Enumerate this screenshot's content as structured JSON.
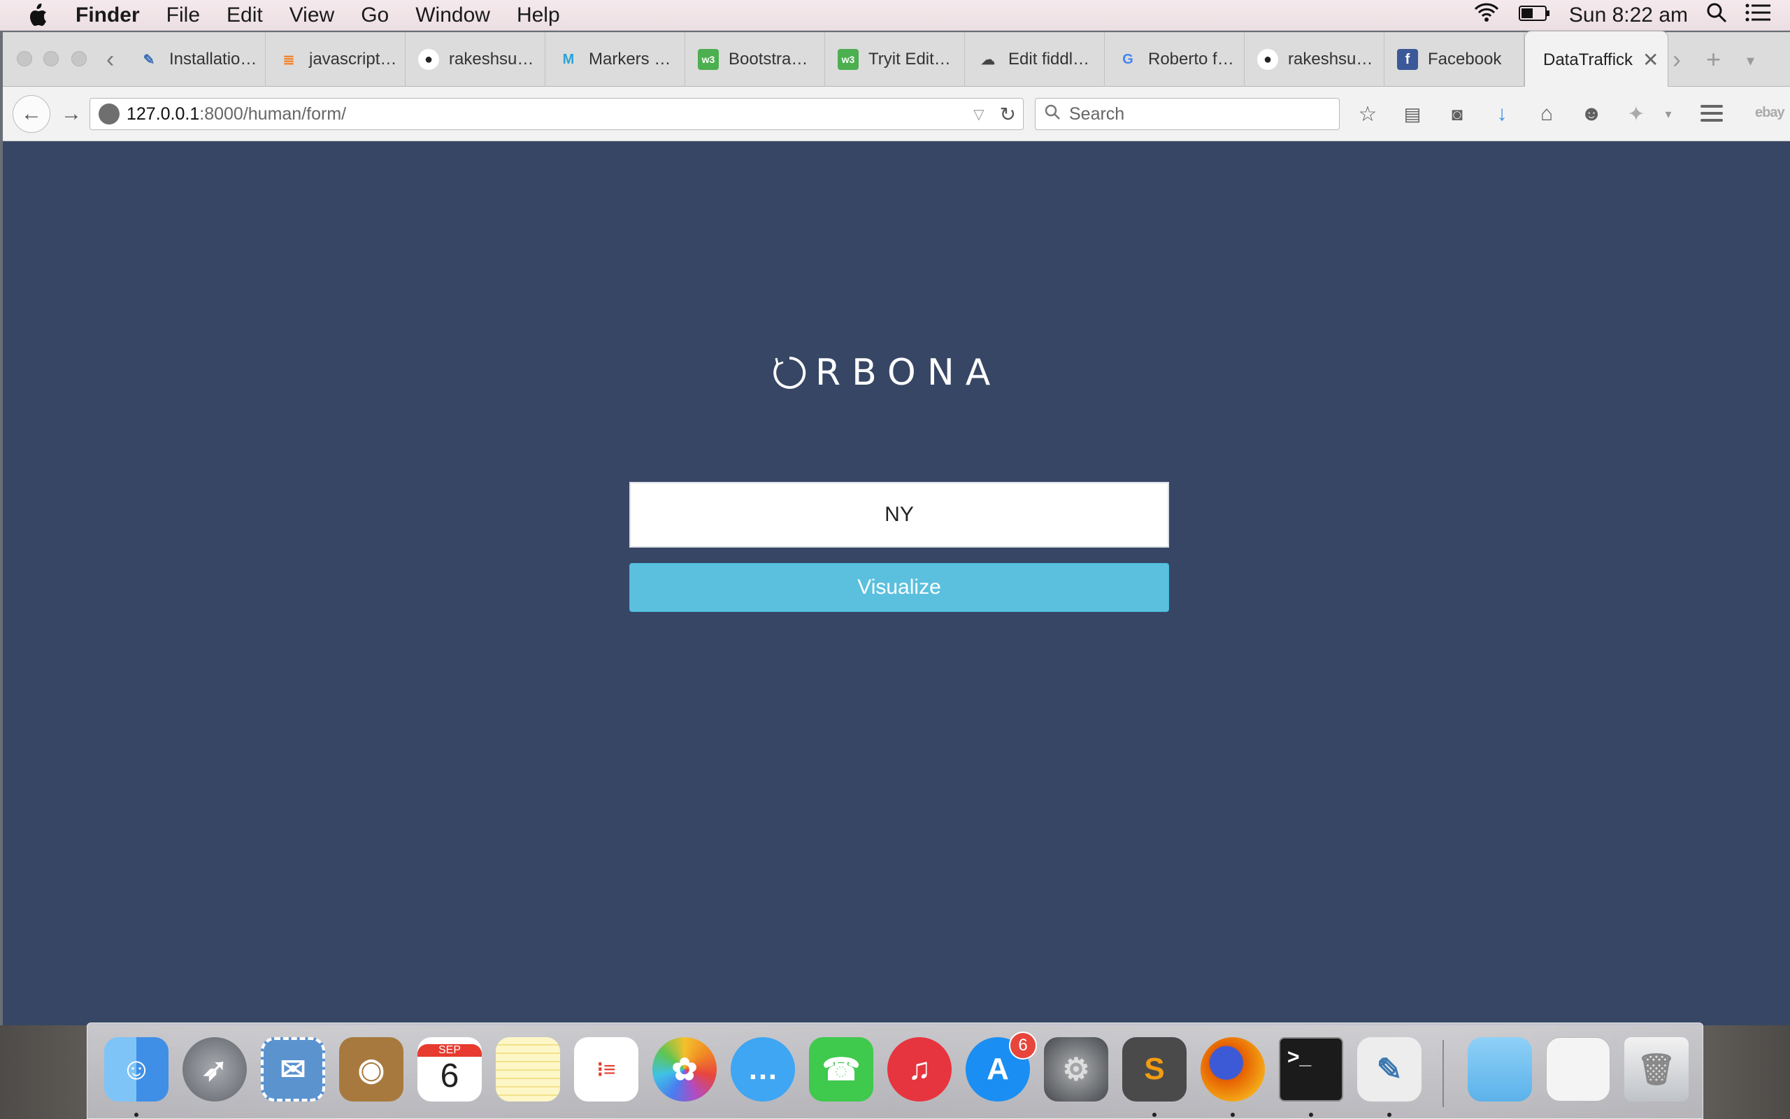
{
  "menubar": {
    "app_name": "Finder",
    "items": [
      "File",
      "Edit",
      "View",
      "Go",
      "Window",
      "Help"
    ],
    "clock": "Sun 8:22 am"
  },
  "browser": {
    "tabs": [
      {
        "label": "Installatio…",
        "icon": "feather-icon",
        "color": "#3d6fb6"
      },
      {
        "label": "javascript…",
        "icon": "stackoverflow-icon",
        "color": "#f48024"
      },
      {
        "label": "rakeshsu…",
        "icon": "github-icon",
        "color": "#222222"
      },
      {
        "label": "Markers …",
        "icon": "m-icon",
        "color": "#2aa4d5"
      },
      {
        "label": "Bootstra…",
        "icon": "w3-icon",
        "color": "#4caf50"
      },
      {
        "label": "Tryit Edit…",
        "icon": "w3-icon",
        "color": "#4caf50"
      },
      {
        "label": "Edit fiddl…",
        "icon": "cloud-icon",
        "color": "#444444"
      },
      {
        "label": "Roberto f…",
        "icon": "google-icon",
        "color": "#4285f4"
      },
      {
        "label": "rakeshsu…",
        "icon": "github-icon",
        "color": "#222222"
      },
      {
        "label": "Facebook",
        "icon": "facebook-icon",
        "color": "#3b5998"
      }
    ],
    "active_tab": {
      "label": "DataTraffick"
    },
    "url": {
      "host": "127.0.0.1",
      "path": ":8000/human/form/"
    },
    "search_placeholder": "Search"
  },
  "page": {
    "logo_text": "RBONA",
    "city_value": "NY",
    "visualize_label": "Visualize",
    "background_color": "#374664",
    "button_color": "#5bc0de"
  },
  "dock": {
    "apps": [
      {
        "name": "finder",
        "glyph": "☺",
        "color": "#3f8fe6",
        "running": true
      },
      {
        "name": "launchpad",
        "glyph": "🚀",
        "color": "#7b7f86",
        "running": false
      },
      {
        "name": "mail",
        "glyph": "✉",
        "color": "#4c87c6",
        "running": false
      },
      {
        "name": "contacts",
        "glyph": "👤",
        "color": "#a8793e",
        "running": false
      },
      {
        "name": "calendar",
        "glyph": "6",
        "color": "#ffffff",
        "running": false
      },
      {
        "name": "notes",
        "glyph": "≡",
        "color": "#f6e28a",
        "running": false
      },
      {
        "name": "reminders",
        "glyph": "☰",
        "color": "#ffffff",
        "running": false
      },
      {
        "name": "photos",
        "glyph": "✿",
        "color": "#f5f5f5",
        "running": false
      },
      {
        "name": "messages",
        "glyph": "💬",
        "color": "#3ea6f2",
        "running": false
      },
      {
        "name": "facetime",
        "glyph": "☎",
        "color": "#3fc94d",
        "running": false
      },
      {
        "name": "itunes",
        "glyph": "♫",
        "color": "#e6353f",
        "running": false
      },
      {
        "name": "app-store",
        "glyph": "A",
        "color": "#1a8ef2",
        "running": false,
        "badge": "6"
      },
      {
        "name": "system-preferences",
        "glyph": "⚙",
        "color": "#6d6f73",
        "running": false
      },
      {
        "name": "sublime-text",
        "glyph": "S",
        "color": "#4a4a4a",
        "running": true
      },
      {
        "name": "firefox",
        "glyph": "●",
        "color": "#e66000",
        "running": true
      },
      {
        "name": "terminal",
        "glyph": ">_",
        "color": "#1b1b1b",
        "running": true
      },
      {
        "name": "python-launcher",
        "glyph": "🐍",
        "color": "#e9e9e9",
        "running": true
      }
    ],
    "calendar_month": "SEP"
  }
}
